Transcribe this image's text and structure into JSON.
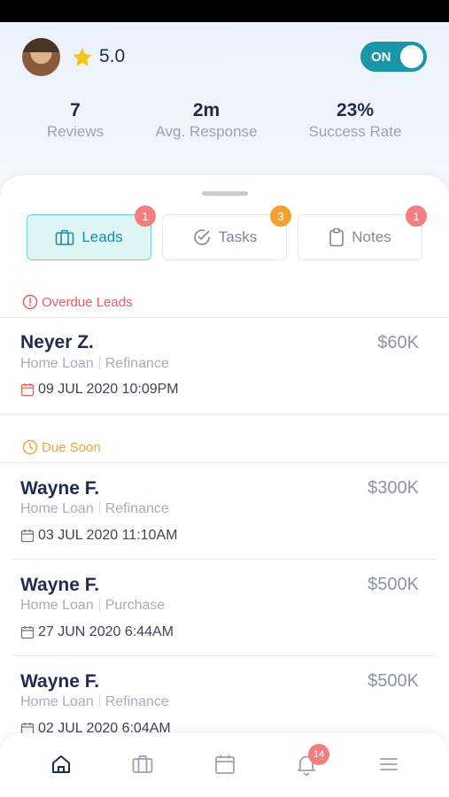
{
  "header": {
    "rating": "5.0",
    "toggle_label": "ON",
    "stats": [
      {
        "value": "7",
        "label": "Reviews"
      },
      {
        "value": "2m",
        "label": "Avg. Response"
      },
      {
        "value": "23%",
        "label": "Success Rate"
      }
    ]
  },
  "tabs": [
    {
      "label": "Leads",
      "badge": "1",
      "active": true
    },
    {
      "label": "Tasks",
      "badge": "3",
      "active": false
    },
    {
      "label": "Notes",
      "badge": "1",
      "active": false
    }
  ],
  "sections": {
    "overdue": {
      "title": "Overdue Leads",
      "color": "#ef5a5a"
    },
    "due_soon": {
      "title": "Due Soon",
      "color": "#f2a33a"
    }
  },
  "leads": [
    {
      "name": "Neyer Z.",
      "amount": "$60K",
      "type": "Home Loan",
      "purpose": "Refinance",
      "date": "09 JUL 2020 10:09PM"
    },
    {
      "name": "Wayne F.",
      "amount": "$300K",
      "type": "Home Loan",
      "purpose": "Refinance",
      "date": "03 JUL 2020 11:10AM"
    },
    {
      "name": "Wayne F.",
      "amount": "$500K",
      "type": "Home Loan",
      "purpose": "Purchase",
      "date": "27 JUN 2020 6:44AM"
    },
    {
      "name": "Wayne F.",
      "amount": "$500K",
      "type": "Home Loan",
      "purpose": "Refinance",
      "date": "02 JUL 2020 6:04AM"
    }
  ],
  "bottom_nav": {
    "items": [
      "home-icon",
      "briefcase-icon",
      "calendar-icon",
      "bell-icon",
      "menu-icon"
    ],
    "notification_badge": "14"
  }
}
